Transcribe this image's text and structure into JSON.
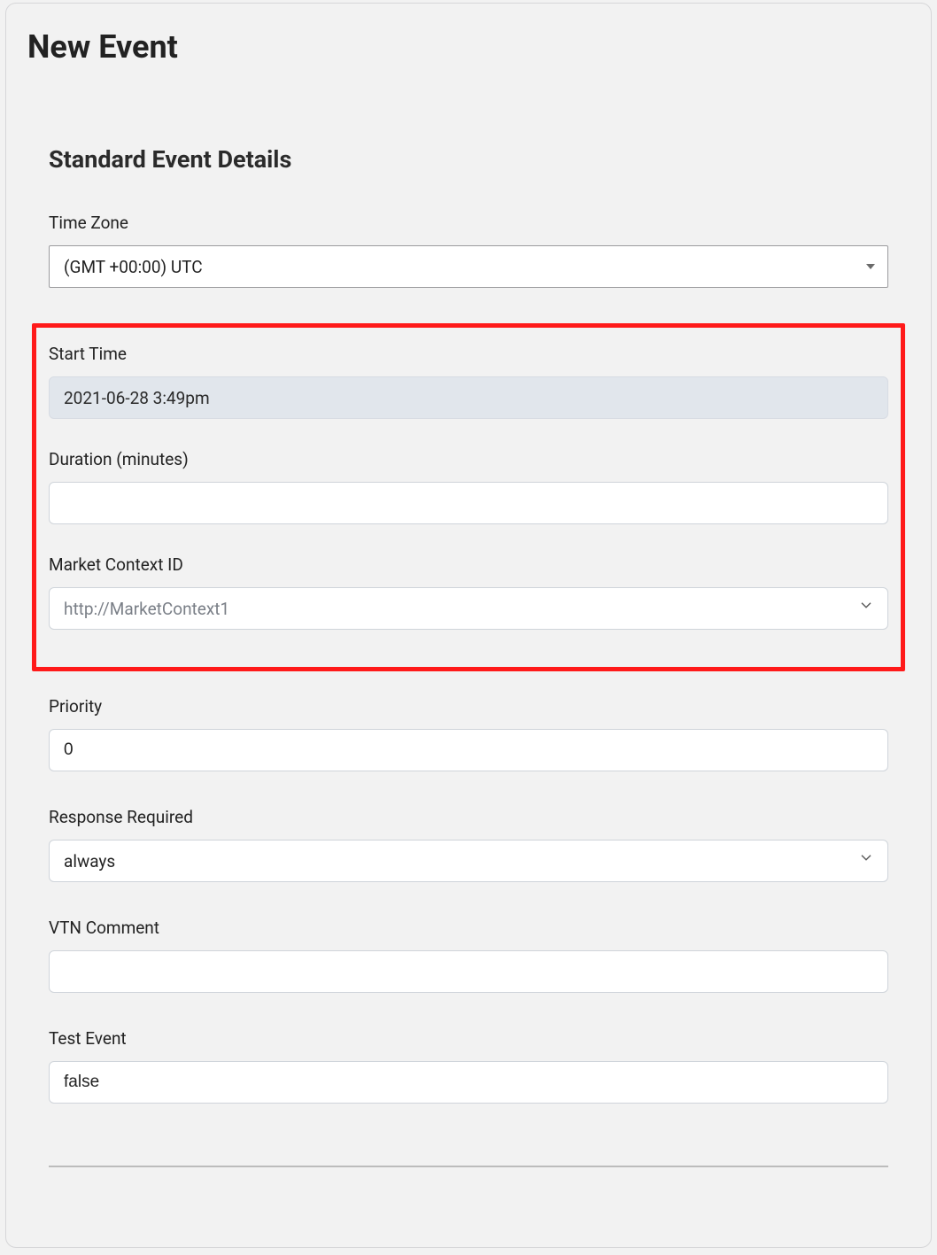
{
  "page": {
    "title": "New Event"
  },
  "section": {
    "title": "Standard Event Details"
  },
  "fields": {
    "timezone": {
      "label": "Time Zone",
      "value": "(GMT +00:00) UTC"
    },
    "start_time": {
      "label": "Start Time",
      "value": "2021-06-28 3:49pm"
    },
    "duration": {
      "label": "Duration (minutes)",
      "value": ""
    },
    "market_context": {
      "label": "Market Context ID",
      "value": "http://MarketContext1"
    },
    "priority": {
      "label": "Priority",
      "value": "0"
    },
    "response_required": {
      "label": "Response Required",
      "value": "always"
    },
    "vtn_comment": {
      "label": "VTN Comment",
      "value": ""
    },
    "test_event": {
      "label": "Test Event",
      "value": "false"
    }
  }
}
